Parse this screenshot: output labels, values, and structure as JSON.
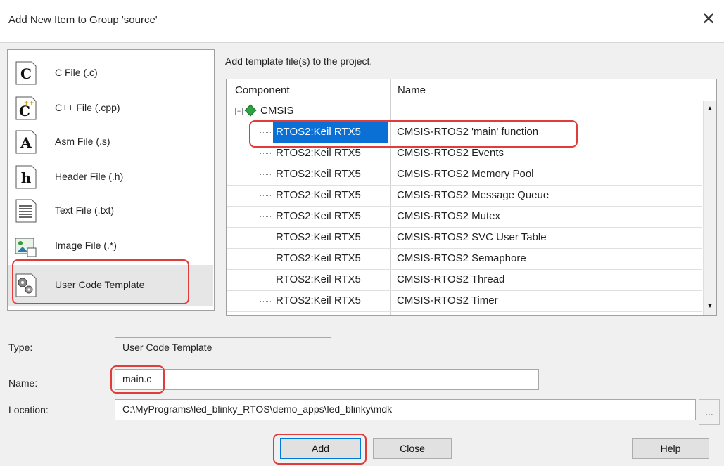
{
  "window": {
    "title": "Add New Item to Group 'source'"
  },
  "file_types": [
    {
      "label": "C File (.c)",
      "icon": "c-file-icon"
    },
    {
      "label": "C++ File (.cpp)",
      "icon": "cpp-file-icon"
    },
    {
      "label": "Asm File (.s)",
      "icon": "asm-file-icon"
    },
    {
      "label": "Header File (.h)",
      "icon": "header-file-icon"
    },
    {
      "label": "Text File (.txt)",
      "icon": "text-file-icon"
    },
    {
      "label": "Image File (.*)",
      "icon": "image-file-icon"
    },
    {
      "label": "User Code Template",
      "icon": "gears-icon",
      "selected": true
    }
  ],
  "templates": {
    "hint": "Add template file(s) to the project.",
    "columns": [
      "Component",
      "Name"
    ],
    "root": "CMSIS",
    "rows": [
      {
        "component": "RTOS2:Keil RTX5",
        "name": "CMSIS-RTOS2 'main' function",
        "selected": true
      },
      {
        "component": "RTOS2:Keil RTX5",
        "name": "CMSIS-RTOS2 Events"
      },
      {
        "component": "RTOS2:Keil RTX5",
        "name": "CMSIS-RTOS2 Memory Pool"
      },
      {
        "component": "RTOS2:Keil RTX5",
        "name": "CMSIS-RTOS2 Message Queue"
      },
      {
        "component": "RTOS2:Keil RTX5",
        "name": "CMSIS-RTOS2 Mutex"
      },
      {
        "component": "RTOS2:Keil RTX5",
        "name": "CMSIS-RTOS2 SVC User Table"
      },
      {
        "component": "RTOS2:Keil RTX5",
        "name": "CMSIS-RTOS2 Semaphore"
      },
      {
        "component": "RTOS2:Keil RTX5",
        "name": "CMSIS-RTOS2 Thread"
      },
      {
        "component": "RTOS2:Keil RTX5",
        "name": "CMSIS-RTOS2 Timer"
      }
    ]
  },
  "fields": {
    "type_label": "Type:",
    "type_value": "User Code Template",
    "name_label": "Name:",
    "name_value": "main.c",
    "location_label": "Location:",
    "location_value": "C:\\MyPrograms\\led_blinky_RTOS\\demo_apps\\led_blinky\\mdk",
    "browse_label": "..."
  },
  "buttons": {
    "add": "Add",
    "close": "Close",
    "help": "Help"
  },
  "colors": {
    "selection": "#0a70d6",
    "highlight": "#e03c3c",
    "default_button_border": "#0078d7"
  }
}
